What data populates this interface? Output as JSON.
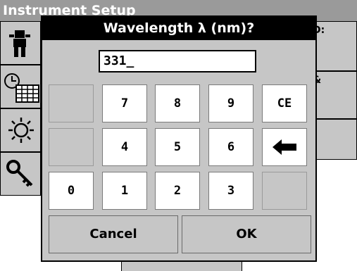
{
  "screen": {
    "title": "Instrument Setup"
  },
  "background": {
    "right_labels": [
      "D:",
      "&"
    ],
    "side_icons": [
      "operator-icon",
      "clock-calendar-icon",
      "lamp-icon",
      "key-icon"
    ]
  },
  "dialog": {
    "title": "Wavelength λ (nm)?",
    "entry_value": "331_",
    "keys": {
      "k7": "7",
      "k8": "8",
      "k9": "9",
      "ce": "CE",
      "k4": "4",
      "k5": "5",
      "k6": "6",
      "k0": "0",
      "k1": "1",
      "k2": "2",
      "k3": "3"
    },
    "backspace_icon": "left-arrow-icon",
    "cancel_label": "Cancel",
    "ok_label": "OK"
  }
}
